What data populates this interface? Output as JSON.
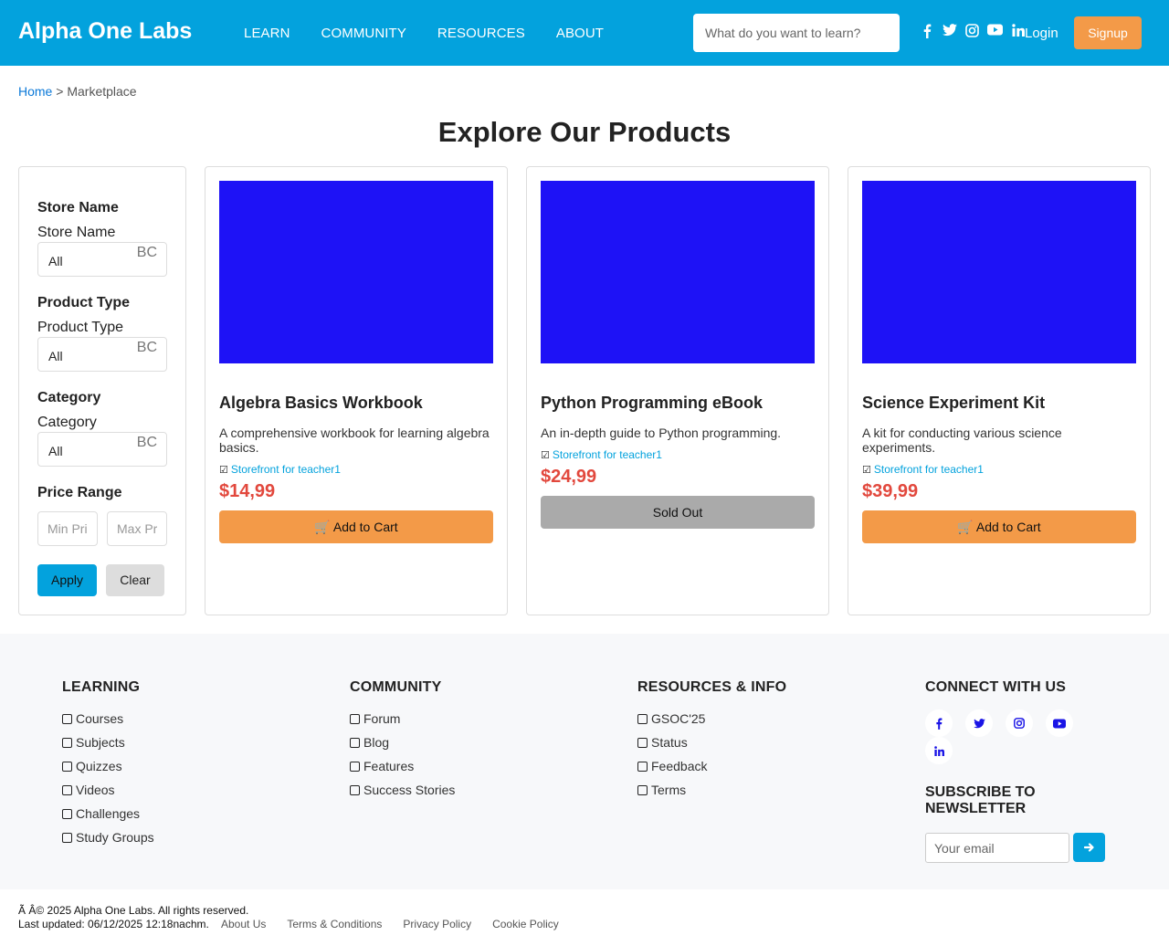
{
  "header": {
    "brand": "Alpha One Labs",
    "nav": [
      "LEARN",
      "COMMUNITY",
      "RESOURCES",
      "ABOUT"
    ],
    "search_placeholder": "What do you want to learn?",
    "social_icons": [
      "facebook-icon",
      "twitter-icon",
      "instagram-icon",
      "youtube-icon",
      "linkedin-icon"
    ],
    "login_label": "Login",
    "signup_label": "Signup"
  },
  "breadcrumb": {
    "home": "Home",
    "separator": ">",
    "current": "Marketplace"
  },
  "page_title": "Explore Our Products",
  "filters": {
    "store": {
      "heading": "Store Name",
      "label": "Store Name",
      "value": "All",
      "indicator": "BC"
    },
    "type": {
      "heading": "Product Type",
      "label": "Product Type",
      "value": "All",
      "indicator": "BC"
    },
    "category": {
      "heading": "Category",
      "label": "Category",
      "value": "All",
      "indicator": "BC"
    },
    "price": {
      "heading": "Price Range",
      "min_placeholder": "Min Pri",
      "max_placeholder": "Max Pr"
    },
    "apply_label": "Apply",
    "clear_label": "Clear"
  },
  "products": [
    {
      "name": "Algebra Basics Workbook",
      "description": "A comprehensive workbook for learning algebra basics.",
      "store": "Storefront for teacher1",
      "price": "$14,99",
      "action": "Add to Cart",
      "sold_out": false,
      "image_color": "#1e12f6"
    },
    {
      "name": "Python Programming eBook",
      "description": "An in-depth guide to Python programming.",
      "store": "Storefront for teacher1",
      "price": "$24,99",
      "action": "Sold Out",
      "sold_out": true,
      "image_color": "#1e12f6"
    },
    {
      "name": "Science Experiment Kit",
      "description": "A kit for conducting various science experiments.",
      "store": "Storefront for teacher1",
      "price": "$39,99",
      "action": "Add to Cart",
      "sold_out": false,
      "image_color": "#1e12f6"
    }
  ],
  "footer": {
    "learning": {
      "heading": "LEARNING",
      "links": [
        "Courses",
        "Subjects",
        "Quizzes",
        "Videos",
        "Challenges",
        "Study Groups"
      ]
    },
    "community": {
      "heading": "COMMUNITY",
      "links": [
        "Forum",
        "Blog",
        "Features",
        "Success Stories"
      ]
    },
    "resources": {
      "heading": "RESOURCES & INFO",
      "links": [
        "GSOC'25",
        "Status",
        "Feedback",
        "Terms"
      ]
    },
    "connect": {
      "heading": "CONNECT WITH US",
      "icons": [
        "facebook-icon",
        "twitter-icon",
        "instagram-icon",
        "youtube-icon",
        "linkedin-icon"
      ]
    },
    "newsletter": {
      "heading": "SUBSCRIBE TO NEWSLETTER",
      "placeholder": "Your email"
    }
  },
  "bottom": {
    "copyright": "Ã   Â© 2025 Alpha One Labs. All rights reserved.",
    "updated": "Last updated: 06/12/2025 12:18nachm.",
    "links": [
      "About Us",
      "Terms & Conditions",
      "Privacy Policy",
      "Cookie Policy"
    ]
  },
  "colors": {
    "primary": "#03a2dd",
    "accent": "#f39a48",
    "price": "#e2483d",
    "sold_out": "#aaaaaa",
    "product_image": "#1e12f6"
  }
}
